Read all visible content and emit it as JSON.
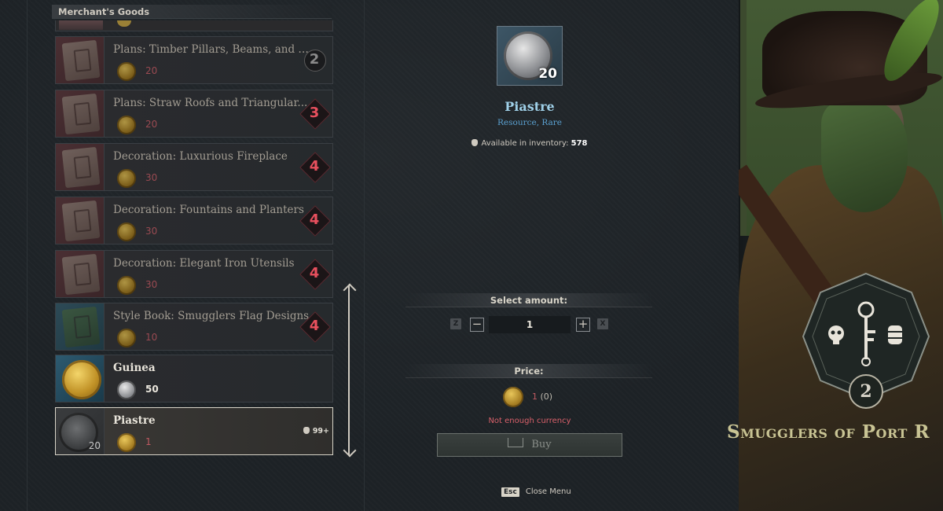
{
  "colors": {
    "unaffordable_price": "#c05a62",
    "rank_locked": "#e8505e",
    "title_blue": "#9fd0e8",
    "subtitle_blue": "#5aa0d0",
    "faction_gold": "#c9c494"
  },
  "shop": {
    "header": "Merchant's Goods",
    "items": [
      {
        "name": "Plans: Timber Pillars, Beams, and F...",
        "price": "20",
        "rank": "2",
        "currency_icon": "gold-coin-icon"
      },
      {
        "name": "Plans: Straw Roofs and Triangular...",
        "price": "20",
        "rank": "3",
        "currency_icon": "gold-coin-icon"
      },
      {
        "name": "Decoration: Luxurious Fireplace",
        "price": "30",
        "rank": "4",
        "currency_icon": "gold-coin-icon"
      },
      {
        "name": "Decoration: Fountains and Planters",
        "price": "30",
        "rank": "4",
        "currency_icon": "gold-coin-icon"
      },
      {
        "name": "Decoration: Elegant Iron Utensils",
        "price": "30",
        "rank": "4",
        "currency_icon": "gold-coin-icon"
      },
      {
        "name": "Style Book: Smugglers Flag Designs",
        "price": "10",
        "rank": "4",
        "currency_icon": "gold-coin-icon"
      },
      {
        "name": "Guinea",
        "price": "50",
        "currency_icon": "silver-coin-icon"
      },
      {
        "name": "Piastre",
        "price": "1",
        "thumb_count": "20",
        "stock": "99+",
        "currency_icon": "gold-coin-icon"
      }
    ]
  },
  "detail": {
    "title": "Piastre",
    "subtitle": "Resource, Rare",
    "icon_count": "20",
    "inventory_label": "Available in inventory:",
    "inventory_value": "578"
  },
  "amount": {
    "header": "Select amount:",
    "value": "1",
    "key_decrease": "Z",
    "key_increase": "X",
    "minus": "−",
    "plus": "+"
  },
  "price": {
    "header": "Price:",
    "cost": "1",
    "owned": "(0)",
    "warning": "Not enough currency",
    "buy_label": "Buy"
  },
  "footer": {
    "esc_key": "Esc",
    "close_label": "Close Menu"
  },
  "faction": {
    "level": "2",
    "name": "Smugglers of Port R"
  }
}
